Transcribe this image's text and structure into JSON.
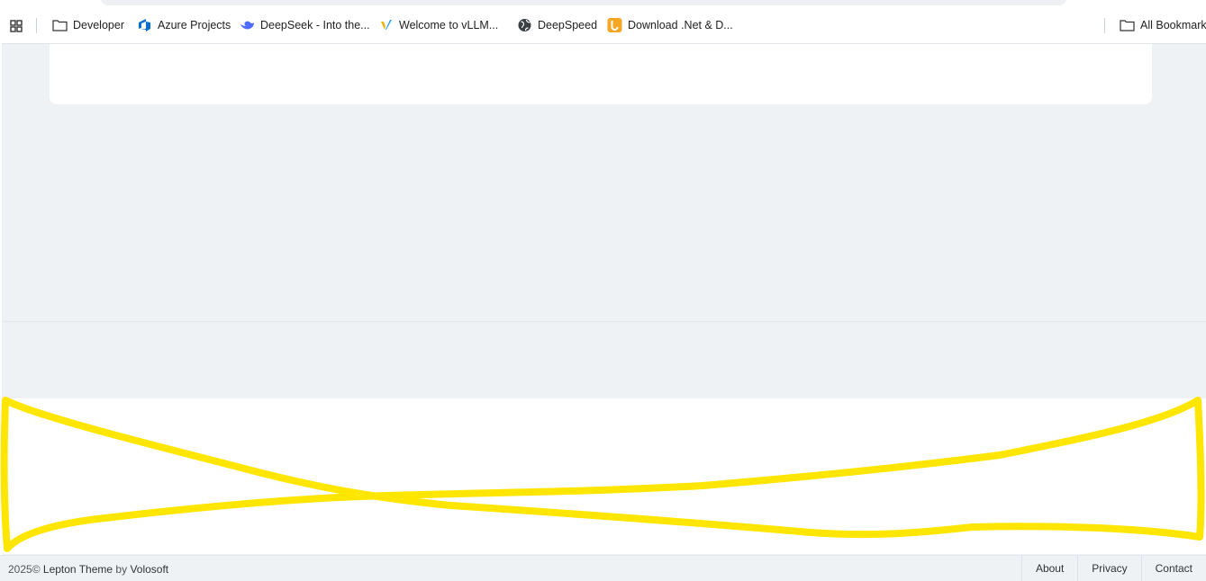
{
  "bookmarks_bar": {
    "items": [
      {
        "label": "Developer",
        "icon": "folder-icon"
      },
      {
        "label": "Azure Projects",
        "icon": "azure-devops-icon"
      },
      {
        "label": "DeepSeek - Into the...",
        "icon": "deepseek-whale-icon"
      },
      {
        "label": "Welcome to vLLM...",
        "icon": "vllm-icon"
      },
      {
        "label": "DeepSpeed",
        "icon": "globe-icon"
      },
      {
        "label": "Download .Net & D...",
        "icon": "download-dotnet-icon"
      }
    ],
    "all_bookmarks_label": "All Bookmark"
  },
  "footer": {
    "year": "2025©",
    "theme": "Lepton Theme",
    "by": "by",
    "author": "Volosoft",
    "links": [
      "About",
      "Privacy",
      "Contact"
    ]
  },
  "colors": {
    "page_background": "#eef2f5",
    "card": "#ffffff",
    "annotation": "#ffe600"
  }
}
